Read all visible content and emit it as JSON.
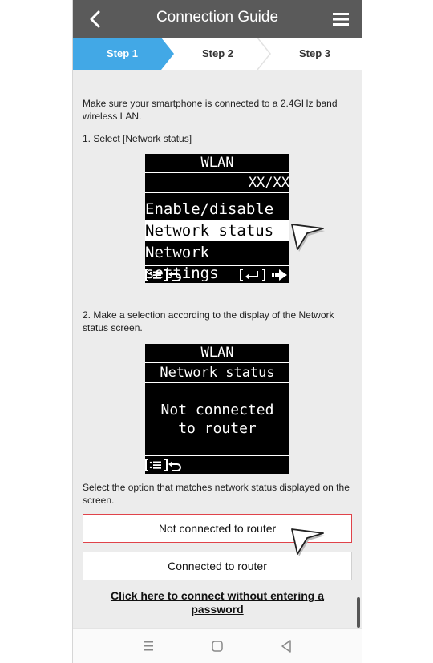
{
  "header": {
    "title": "Connection Guide"
  },
  "steps": [
    {
      "label": "Step 1",
      "active": true
    },
    {
      "label": "Step 2",
      "active": false
    },
    {
      "label": "Step 3",
      "active": false
    }
  ],
  "content": {
    "intro": "Make sure your smartphone is connected to a 2.4GHz band wireless LAN.",
    "step1_instruction": "1. Select [Network status]",
    "lcd1": {
      "title": "WLAN",
      "date": "XX/XX",
      "items": [
        "Enable/disable",
        "Network status",
        "Network settings"
      ],
      "selected_item": "Network status"
    },
    "step2_instruction": "2. Make a selection according to the display of the Network status screen.",
    "lcd2": {
      "title": "WLAN",
      "subtitle": "Network status",
      "message_line1": "Not connected",
      "message_line2": "to router"
    },
    "select_instruction": "Select the option that matches network status displayed on the screen.",
    "options": [
      {
        "label": "Not connected to router",
        "selected": true
      },
      {
        "label": "Connected to router",
        "selected": false
      }
    ],
    "link": "Click here to connect without entering a password"
  },
  "colors": {
    "header_bg": "#5a5a5a",
    "step_active": "#42a8e6",
    "selected_border": "#e0434a",
    "page_bg": "#ececec"
  },
  "icons": [
    "back-arrow-icon",
    "hamburger-menu-icon",
    "menu-bracket-icon",
    "return-icon",
    "enter-icon",
    "pointer-cursor-icon",
    "nav-recents-icon",
    "nav-home-icon",
    "nav-back-icon"
  ]
}
